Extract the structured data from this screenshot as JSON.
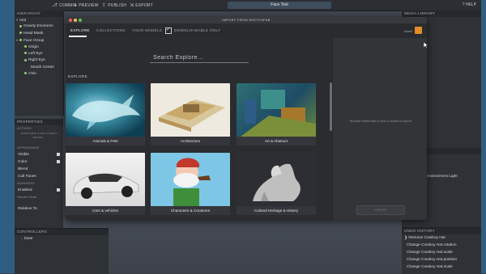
{
  "toolbar": {
    "commit": "COMMIT",
    "preview": "PREVIEW",
    "publish": "PUBLISH",
    "export": "EXPORT",
    "document_title": "Face Test",
    "help": "HELP"
  },
  "hierarchy": {
    "header": "HIERARCHY",
    "items": [
      "root",
      "Gravity Environm",
      "Head Mask",
      "Face Group",
      "Origin",
      "Left Eye",
      "Right Eye",
      "Mouth Center",
      "Chin"
    ]
  },
  "properties": {
    "header": "PROPERTIES",
    "sub_actions": "ACTIONS",
    "hint": "Actions give a user a way to interact...",
    "sub_appearance": "APPEARANCE",
    "rows": [
      "Visible",
      "Color",
      "Blend",
      "Cull Faces"
    ],
    "sub_advanced": "ADVANCED",
    "enabled": "Enabled",
    "render_order": "Render Order",
    "relative_to": "Relative To"
  },
  "controllers": {
    "header": "CONTROLLERS",
    "item": "base"
  },
  "media_library": {
    "header": "MEDIA LIBRARY"
  },
  "actions_panel": {
    "header": "ACTIONS",
    "item": "Environment Light"
  },
  "undo_history": {
    "header": "UNDO HISTORY",
    "items": [
      "Remove Cowboy Hat",
      "Change Cowboy Hat.rotation",
      "Change Cowboy Hat.scale",
      "Change Cowboy Hat.position",
      "Change Cowboy Hat.scale"
    ]
  },
  "modal": {
    "title": "IMPORT FROM SKETCHFAB",
    "tabs": [
      "EXPLORE",
      "COLLECTIONS",
      "YOUR MODELS"
    ],
    "downloadable_label": "DOWNLOADABLE ONLY",
    "downloadable_checked": true,
    "user_label": "cubedl",
    "search_placeholder": "Search Explore...",
    "section_label": "EXPLORE",
    "side_hint": "Browse Sketchfab to find a model to import",
    "import_button": "IMPORT",
    "categories": [
      "Animals & Pets",
      "Architecture",
      "Art & Abstract",
      "Cars & vehicles",
      "Characters & Creatures",
      "Cultural Heritage & History"
    ]
  },
  "colors": {
    "modal_bg": "#2a2b2f",
    "desktop_blue": "#2f5e82",
    "accent_green": "#8fd16a",
    "avatar_orange": "#e58b2a"
  }
}
